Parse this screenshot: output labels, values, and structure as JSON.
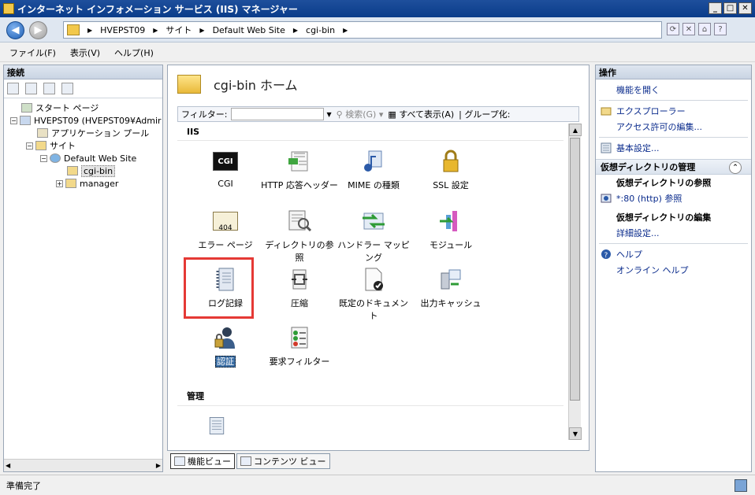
{
  "window": {
    "title": "インターネット インフォメーション サービス (IIS) マネージャー"
  },
  "address": {
    "crumbs": [
      "HVEPST09",
      "サイト",
      "Default Web Site",
      "cgi-bin"
    ]
  },
  "menu": [
    "ファイル(F)",
    "表示(V)",
    "ヘルプ(H)"
  ],
  "left": {
    "header": "接続",
    "tree": {
      "start": "スタート ページ",
      "server": "HVEPST09 (HVEPST09¥Admir",
      "apppool": "アプリケーション プール",
      "sites": "サイト",
      "site": "Default Web Site",
      "cgibin": "cgi-bin",
      "manager": "manager"
    }
  },
  "center": {
    "title": "cgi-bin ホーム",
    "filter_label": "フィルター:",
    "search": "検索(G)",
    "show_all": "すべて表示(A)",
    "group": "グループ化:",
    "group_iis": "IIS",
    "group_manage": "管理",
    "features": [
      "CGI",
      "HTTP 応答ヘッダー",
      "MIME の種類",
      "SSL 設定",
      "エラー ページ",
      "ディレクトリの参照",
      "ハンドラー マッピング",
      "モジュール",
      "ログ記録",
      "圧縮",
      "既定のドキュメント",
      "出力キャッシュ",
      "認証",
      "要求フィルター"
    ],
    "cgi_badge": "CGI",
    "err_badge": "404"
  },
  "viewtabs": {
    "features": "機能ビュー",
    "content": "コンテンツ ビュー"
  },
  "actions": {
    "header": "操作",
    "open_feature": "機能を開く",
    "explore": "エクスプローラー",
    "edit_perms": "アクセス許可の編集...",
    "basic": "基本設定...",
    "vdir_manage": "仮想ディレクトリの管理",
    "vdir_browse": "仮想ディレクトリの参照",
    "browse80": "*:80 (http) 参照",
    "vdir_edit": "仮想ディレクトリの編集",
    "advanced": "詳細設定...",
    "help": "ヘルプ",
    "online_help": "オンライン ヘルプ"
  },
  "status": {
    "text": "準備完了"
  }
}
